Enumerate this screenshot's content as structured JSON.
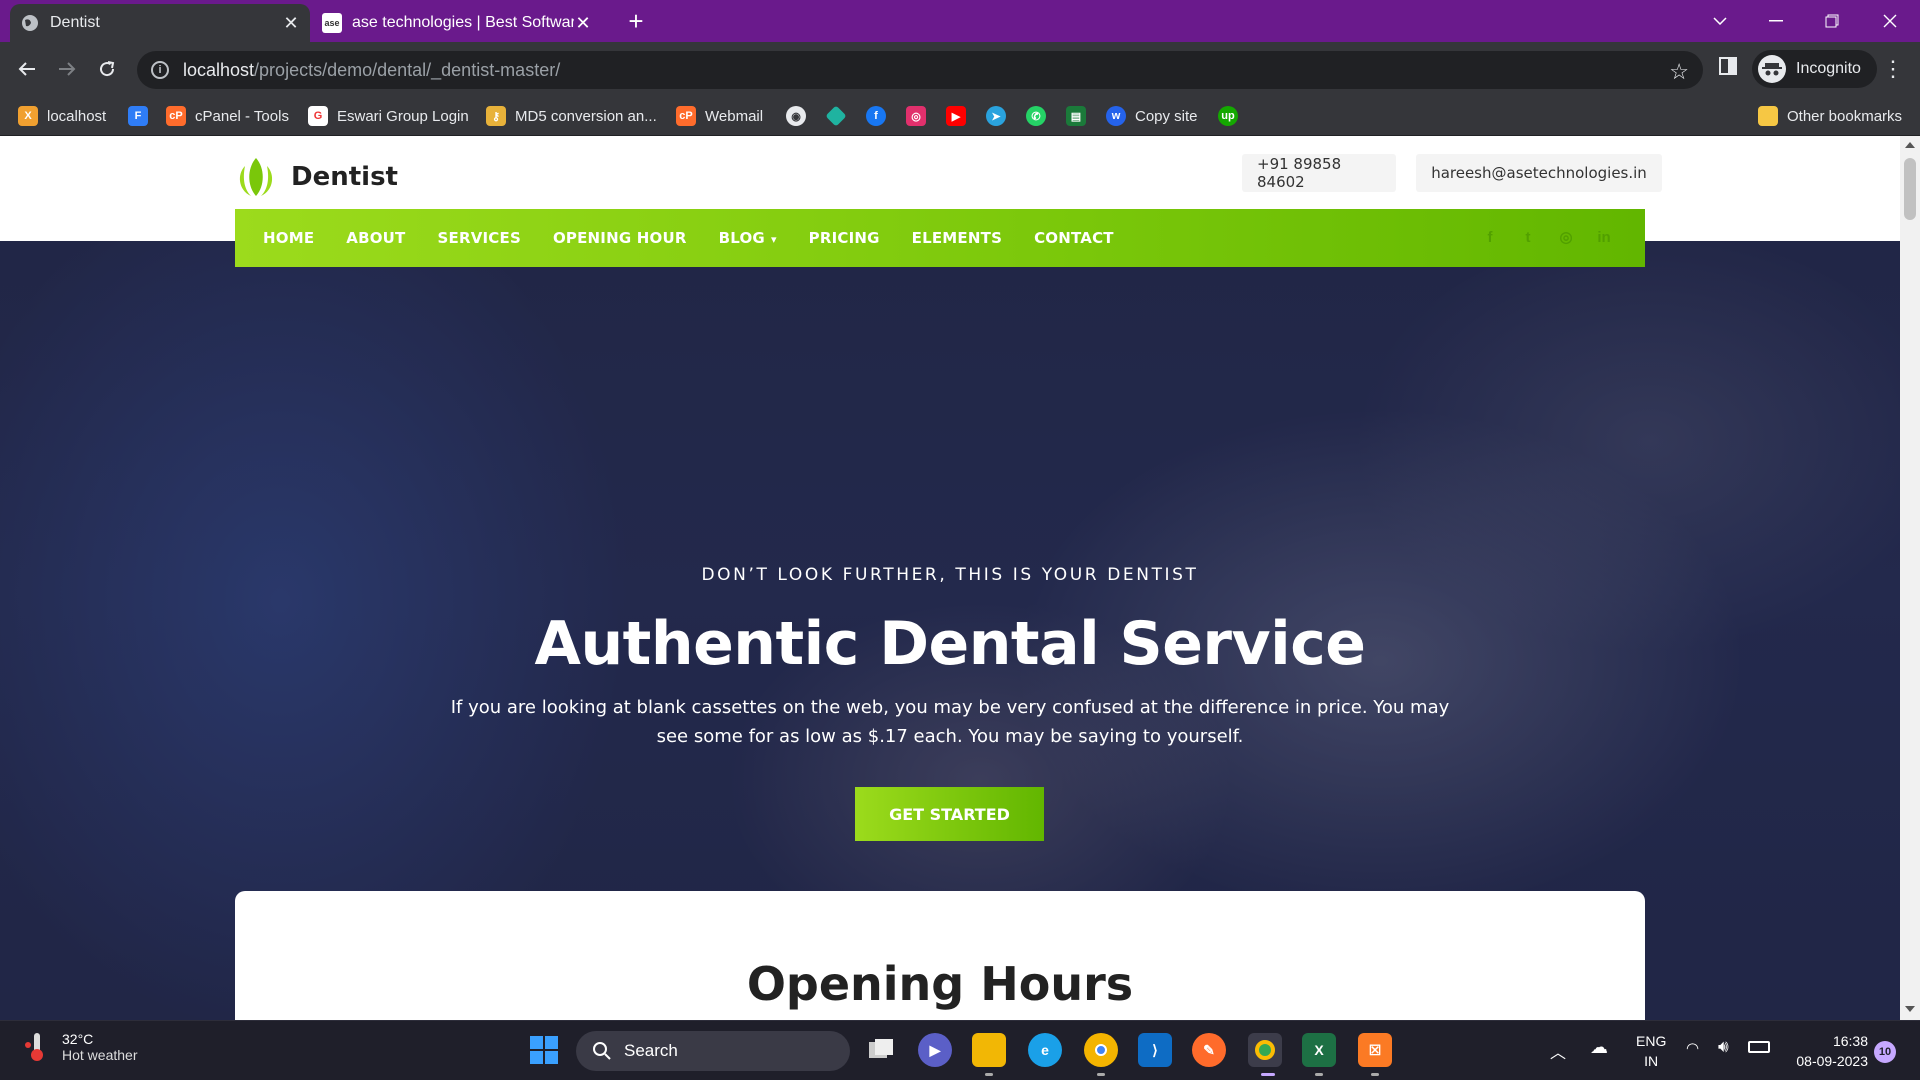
{
  "browser": {
    "tabs": [
      {
        "title": "Dentist",
        "active": true
      },
      {
        "title": "ase technologies | Best Software",
        "active": false,
        "favicon_text": "ase"
      }
    ],
    "url_host": "localhost",
    "url_path": "/projects/demo/dental/_dentist-master/",
    "profile_label": "Incognito",
    "bookmarks": [
      {
        "label": "localhost",
        "icon": "xampp-icon",
        "color": "#f0a030"
      },
      {
        "label": "",
        "icon": "f-logo-icon",
        "color": "#2f7df6"
      },
      {
        "label": "cPanel - Tools",
        "icon": "cpanel-icon",
        "color": "#ff6c2c"
      },
      {
        "label": "Eswari Group Login",
        "icon": "eswari-icon",
        "color": "#e33"
      },
      {
        "label": "MD5 conversion an...",
        "icon": "key-icon",
        "color": "#e8b23a"
      },
      {
        "label": "Webmail",
        "icon": "cpanel-icon",
        "color": "#ff6c2c"
      },
      {
        "label": "",
        "icon": "github-icon",
        "color": "#e8eaed"
      },
      {
        "label": "",
        "icon": "diamond-icon",
        "color": "#1fb3a0"
      },
      {
        "label": "",
        "icon": "facebook-icon",
        "color": "#1877f2"
      },
      {
        "label": "",
        "icon": "instagram-icon",
        "color": "#e1306c"
      },
      {
        "label": "",
        "icon": "youtube-icon",
        "color": "#ff0000"
      },
      {
        "label": "",
        "icon": "telegram-icon",
        "color": "#2aa3de"
      },
      {
        "label": "",
        "icon": "whatsapp-icon",
        "color": "#25d366"
      },
      {
        "label": "",
        "icon": "sheet-icon",
        "color": "#1b7a3a"
      },
      {
        "label": "Copy site",
        "icon": "w-icon",
        "color": "#2563eb"
      },
      {
        "label": "",
        "icon": "upwork-icon",
        "color": "#14a800"
      }
    ],
    "other_bookmarks": "Other bookmarks"
  },
  "site": {
    "brand": "Dentist",
    "phone": "+91 89858 84602",
    "email": "hareesh@asetechnologies.in",
    "accent": "#7ac70a",
    "nav": [
      {
        "label": "HOME"
      },
      {
        "label": "ABOUT"
      },
      {
        "label": "SERVICES"
      },
      {
        "label": "OPENING HOUR"
      },
      {
        "label": "BLOG",
        "has_dropdown": true
      },
      {
        "label": "PRICING"
      },
      {
        "label": "ELEMENTS"
      },
      {
        "label": "CONTACT"
      }
    ],
    "social": [
      {
        "icon": "facebook-icon",
        "glyph": "f"
      },
      {
        "icon": "twitter-icon",
        "glyph": "t"
      },
      {
        "icon": "instagram-icon",
        "glyph": "◎"
      },
      {
        "icon": "linkedin-icon",
        "glyph": "in"
      }
    ],
    "hero": {
      "tagline": "DON’T LOOK FURTHER, THIS IS YOUR DENTIST",
      "headline": "Authentic Dental Service",
      "subtext": "If you are looking at blank cassettes on the web, you may be very confused at the difference in price. You may see some for as low as $.17 each. You may be saying to yourself.",
      "cta": "GET STARTED"
    },
    "hours_title": "Opening Hours"
  },
  "taskbar": {
    "weather_temp": "32°C",
    "weather_desc": "Hot weather",
    "search_placeholder": "Search",
    "lang_primary": "ENG",
    "lang_secondary": "IN",
    "time": "16:38",
    "date": "08-09-2023",
    "notifications": "10"
  }
}
